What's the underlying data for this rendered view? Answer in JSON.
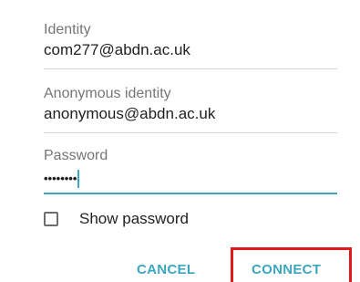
{
  "identity": {
    "label": "Identity",
    "value": "com277@abdn.ac.uk"
  },
  "anonymous_identity": {
    "label": "Anonymous identity",
    "value": "anonymous@abdn.ac.uk"
  },
  "password": {
    "label": "Password",
    "masked_value": "••••••••"
  },
  "show_password": {
    "label": "Show password",
    "checked": false
  },
  "buttons": {
    "cancel": "CANCEL",
    "connect": "CONNECT"
  },
  "colors": {
    "accent": "#3aa6bf",
    "highlight_box": "#e01919"
  }
}
